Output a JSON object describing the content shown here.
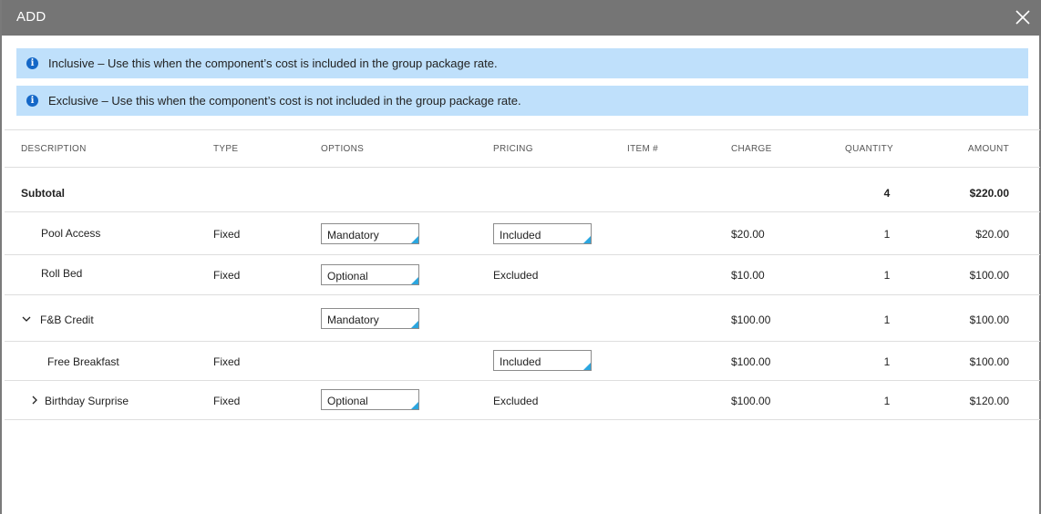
{
  "header": {
    "title": "ADD",
    "close_icon": "close-icon"
  },
  "banners": [
    {
      "icon": "info-icon",
      "text": "Inclusive – Use this when the component’s cost is included in the group package rate."
    },
    {
      "icon": "info-icon",
      "text": "Exclusive – Use this when the component’s cost is not included in the group package rate."
    }
  ],
  "table": {
    "columns": [
      "DESCRIPTION",
      "TYPE",
      "OPTIONS",
      "PRICING",
      "ITEM #",
      "CHARGE",
      "QUANTITY",
      "AMOUNT"
    ],
    "subtotal": {
      "label": "Subtotal",
      "quantity": "4",
      "amount": "$220.00"
    },
    "rows": [
      {
        "description": "Pool Access",
        "type": "Fixed",
        "options": "Mandatory",
        "pricing": "Included",
        "pricing_is_select": true,
        "charge": "$20.00",
        "quantity": "1",
        "amount": "$20.00"
      },
      {
        "description": "Roll Bed",
        "type": "Fixed",
        "options": "Optional",
        "pricing": "Excluded",
        "pricing_is_select": false,
        "charge": "$10.00",
        "quantity": "1",
        "amount": "$100.00"
      },
      {
        "description": "F&B Credit",
        "expander": "chevron-down-icon",
        "type": "",
        "options": "Mandatory",
        "pricing": "",
        "charge": "$100.00",
        "quantity": "1",
        "amount": "$100.00"
      },
      {
        "description": "Free Breakfast",
        "type": "Fixed",
        "options": "",
        "pricing": "Included",
        "pricing_is_select": true,
        "charge": "$100.00",
        "quantity": "1",
        "amount": "$100.00"
      },
      {
        "description": "Birthday Surprise",
        "expander": "chevron-right-icon",
        "type": "Fixed",
        "options": "Optional",
        "pricing": "Excluded",
        "pricing_is_select": false,
        "charge": "$100.00",
        "quantity": "1",
        "amount": "$120.00"
      }
    ]
  },
  "colors": {
    "header_bg": "#757575",
    "banner_bg": "#bfe0fb",
    "info_icon": "#1467c7",
    "select_corner": "#2ba6df"
  }
}
